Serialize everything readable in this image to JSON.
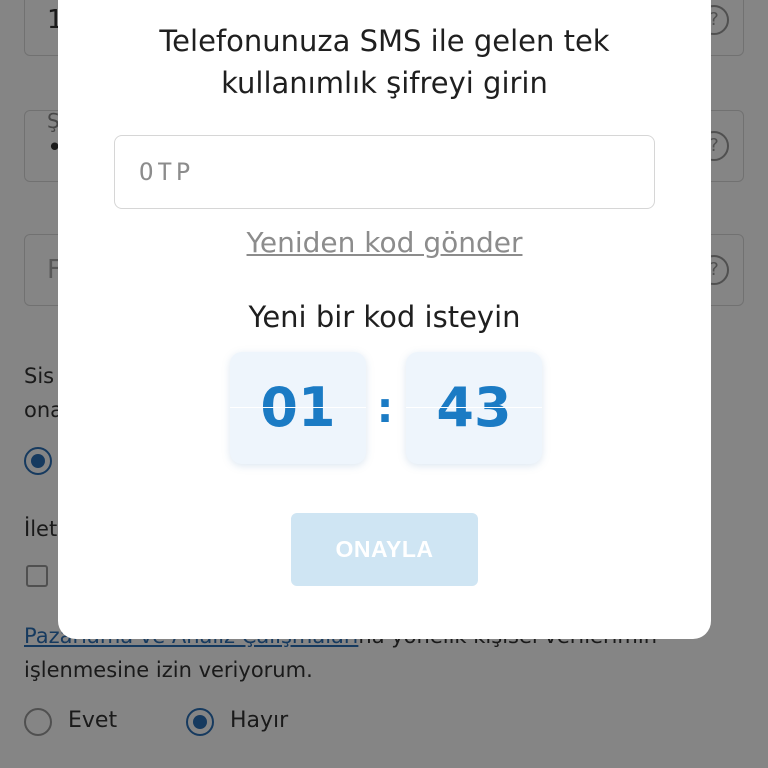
{
  "background": {
    "phone_field_value": "1",
    "password_field_label": "Ş",
    "password_field_value": "•",
    "third_field_placeholder": "F",
    "help_glyph": "?",
    "consent_text_line1": "Sis",
    "consent_text_line2": "ona",
    "comms_text": "İlet",
    "marketing_link": "Pazarlama ve Analiz Çalışmaları",
    "marketing_text_rest": "na yönelik kişisel verilerimin",
    "marketing_text_line2": "işlenmesine izin veriyorum.",
    "radio_yes_label": "Evet",
    "radio_no_label": "Hayır",
    "radio_selected": "Hayır"
  },
  "modal": {
    "title_line1": "Telefonunuza SMS ile gelen tek",
    "title_line2": "kullanımlık şifreyi girin",
    "otp_placeholder": "OTP",
    "otp_value": "",
    "resend_link": "Yeniden kod gönder",
    "request_label": "Yeni bir kod isteyin",
    "timer": {
      "minutes": "01",
      "separator": ":",
      "seconds": "43"
    },
    "confirm_button": "ONAYLA"
  },
  "colors": {
    "accent": "#1b7bc4",
    "link": "#2b6fb6",
    "button_disabled_bg": "#cfe5f3",
    "timer_bg": "#eef5fc"
  }
}
